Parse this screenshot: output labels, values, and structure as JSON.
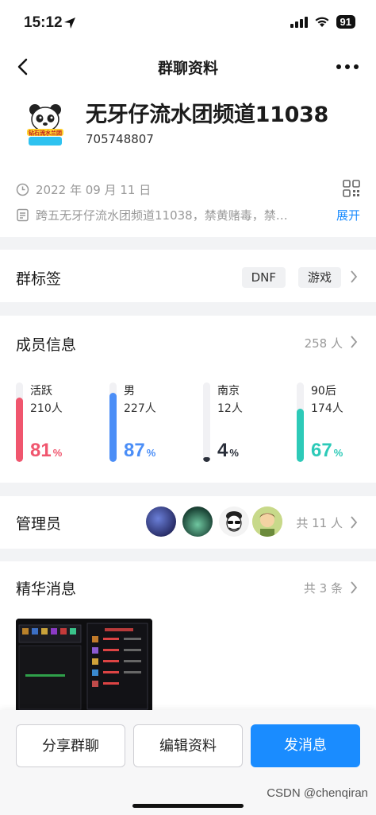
{
  "status_bar": {
    "time": "15:12",
    "battery": "91"
  },
  "nav": {
    "title": "群聊资料"
  },
  "group": {
    "name": "无牙仔流水团频道11038",
    "id": "705748807",
    "avatar_text": "钻石流水兰团",
    "created": "2022 年 09 月 11 日",
    "description": "跨五无牙仔流水团频道11038，禁黄赌毒，禁…",
    "expand_label": "展开"
  },
  "tags": {
    "title": "群标签",
    "items": [
      "DNF",
      "游戏"
    ]
  },
  "members": {
    "title": "成员信息",
    "total": "258 人",
    "stats": [
      {
        "label": "活跃",
        "count": "210人",
        "percent": "81",
        "unit": "%",
        "value": 81,
        "color": "#f0566e"
      },
      {
        "label": "男",
        "count": "227人",
        "percent": "87",
        "unit": "%",
        "value": 87,
        "color": "#4b8ef7"
      },
      {
        "label": "南京",
        "count": "12人",
        "percent": "4",
        "unit": "%",
        "value": 4,
        "color": "#2a2f3a"
      },
      {
        "label": "90后",
        "count": "174人",
        "percent": "67",
        "unit": "%",
        "value": 67,
        "color": "#2dcab8"
      }
    ]
  },
  "admins": {
    "title": "管理员",
    "count": "共 11 人"
  },
  "essence": {
    "title": "精华消息",
    "count": "共 3 条"
  },
  "actions": {
    "share": "分享群聊",
    "edit": "编辑资料",
    "send": "发消息"
  },
  "watermark": "CSDN @chenqiran"
}
